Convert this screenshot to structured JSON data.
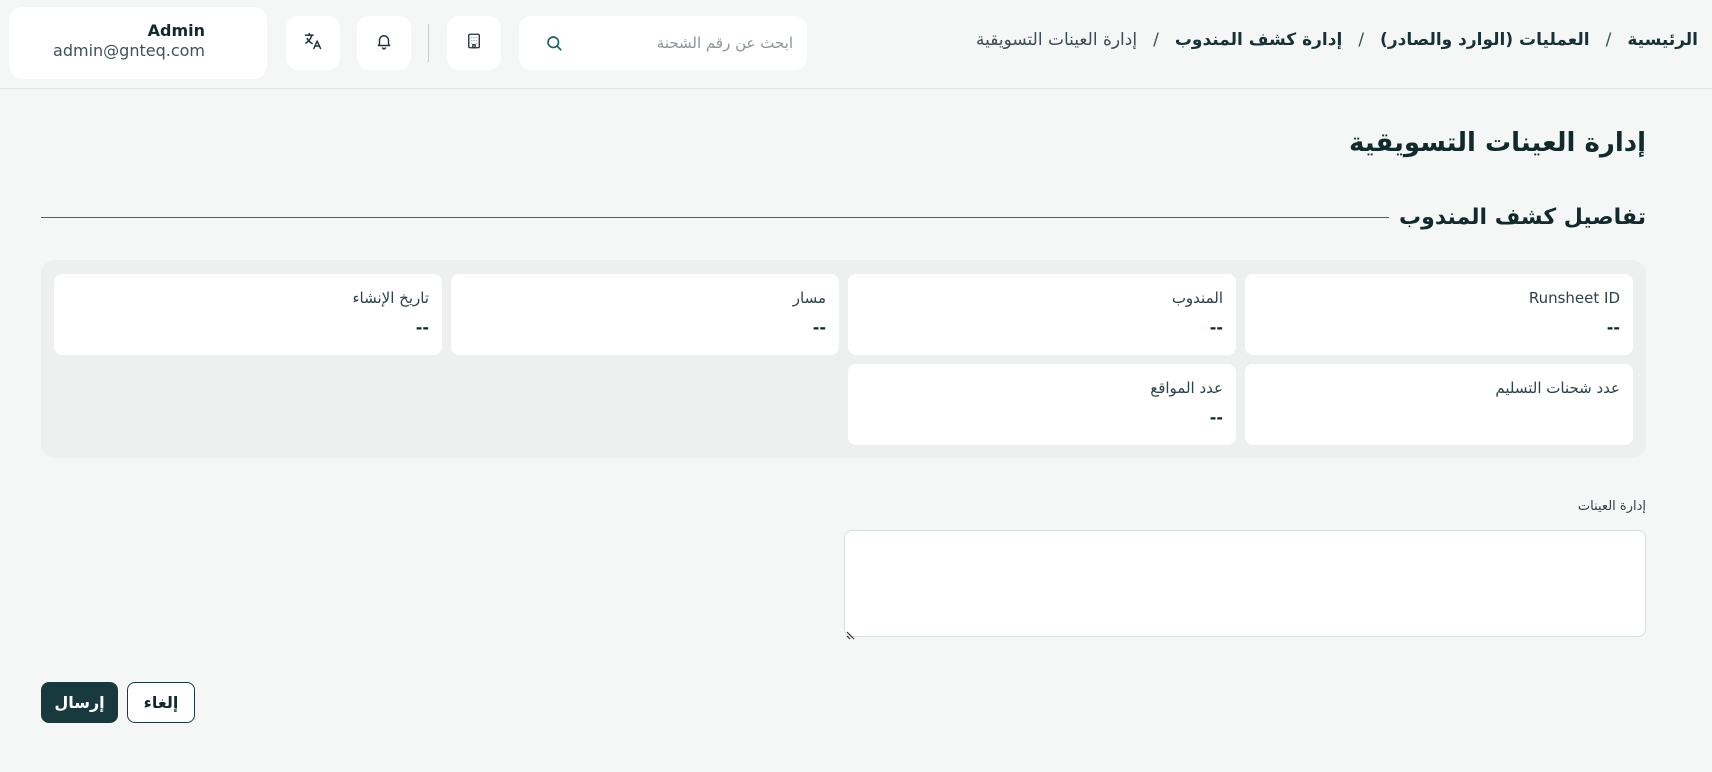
{
  "breadcrumb": {
    "items": [
      {
        "label": "الرئيسية"
      },
      {
        "label": "العمليات (الوارد والصادر)"
      },
      {
        "label": "إدارة كشف المندوب"
      },
      {
        "label": "إدارة العينات التسويقية"
      }
    ],
    "separator": "/"
  },
  "search": {
    "placeholder": "ابحث عن رقم الشحنة"
  },
  "user": {
    "name": "Admin",
    "email": "admin@gnteq.com"
  },
  "page": {
    "title": "إدارة العينات التسويقية"
  },
  "section": {
    "title": "تفاصيل كشف المندوب"
  },
  "details": {
    "runsheet_id": {
      "label": "Runsheet ID",
      "value": "--"
    },
    "courier": {
      "label": "المندوب",
      "value": "--"
    },
    "route": {
      "label": "مسار",
      "value": "--"
    },
    "created_at": {
      "label": "تاريخ الإنشاء",
      "value": "--"
    },
    "delivery_shipments": {
      "label": "عدد شحنات التسليم",
      "value": ""
    },
    "locations": {
      "label": "عدد المواقع",
      "value": "--"
    }
  },
  "notes": {
    "label": "إدارة العينات",
    "value": ""
  },
  "actions": {
    "submit": "إرسال",
    "cancel": "إلغاء"
  },
  "colors": {
    "primary": "#183a3f",
    "background": "#f5f7f6",
    "accent_line": "#2e6e78"
  },
  "icons": [
    "search-icon",
    "building-icon",
    "bell-icon",
    "translate-icon"
  ]
}
